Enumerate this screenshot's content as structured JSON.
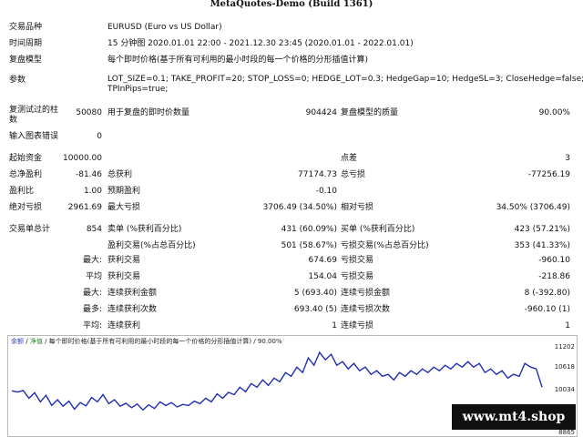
{
  "window": {
    "title": "MetaQuotes-Demo (Build 1361)"
  },
  "report": {
    "symbol_label": "交易品种",
    "symbol_value": "EURUSD (Euro vs US Dollar)",
    "period_label": "时间周期",
    "period_value": "15 分钟图 2020.01.01 22:00 - 2021.12.30 23:45 (2020.01.01 - 2022.01.01)",
    "model_label": "复盘模型",
    "model_value": "每个即时价格(基于所有可利用的最小时段的每一个价格的分形插值计算)",
    "params_label": "参数",
    "params_line1": "LOT_SIZE=0.1; TAKE_PROFIT=20; STOP_LOSS=0; HEDGE_LOT=0.3; HedgeGap=10; HedgeSL=3; CloseHedge=false;",
    "params_line2": "TPInPips=true;",
    "bars_label_1": "复测试过的柱",
    "bars_label_2": "数",
    "bars_value": "50080",
    "ticks_label": "用于复盘的即时价数量",
    "ticks_value": "904424",
    "quality_label": "复盘模型的质量",
    "quality_value": "90.00%",
    "errors_label": "输入图表错误",
    "errors_value": "0",
    "deposit_label": "起始资金",
    "deposit_value": "10000.00",
    "spread_label": "点差",
    "spread_value": "3",
    "net_label": "总净盈利",
    "net_value": "-81.46",
    "gross_profit_label": "总获利",
    "gross_profit_value": "77174.73",
    "gross_loss_label": "总亏损",
    "gross_loss_value": "-77256.19",
    "pf_label": "盈利比",
    "pf_value": "1.00",
    "payoff_label": "预期盈利",
    "payoff_value": "-0.10",
    "abs_dd_label": "绝对亏损",
    "abs_dd_value": "2961.69",
    "max_dd_label": "最大亏损",
    "max_dd_value": "3706.49 (34.50%)",
    "rel_dd_label": "相对亏损",
    "rel_dd_value": "34.50% (3706.49)",
    "trades_label": "交易单总计",
    "trades_value": "854",
    "short_label": "卖单 (%获利百分比)",
    "short_value": "431 (60.09%)",
    "long_label": "买单 (%获利百分比)",
    "long_value": "423 (57.21%)",
    "win_label": "盈利交易(%占总百分比)",
    "win_value": "501 (58.67%)",
    "loss_label": "亏损交易(%占总百分比)",
    "loss_value": "353 (41.33%)",
    "largest_label": "最大:",
    "largest_win_label": "获利交易",
    "largest_win_value": "674.69",
    "largest_loss_label": "亏损交易",
    "largest_loss_value": "-960.10",
    "avg_label": "平均",
    "avg_win_label": "获利交易",
    "avg_win_value": "154.04",
    "avg_loss_label": "亏损交易",
    "avg_loss_value": "-218.86",
    "max_cons_label": "最大:",
    "max_cons_win_label": "连续获利金额",
    "max_cons_win_value": "5 (693.40)",
    "max_cons_loss_label": "连续亏损金额",
    "max_cons_loss_value": "8 (-392.80)",
    "most_label": "最多:",
    "most_cons_win_label": "连续获利次数",
    "most_cons_win_value": "693.40 (5)",
    "most_cons_loss_label": "连续亏损次数",
    "most_cons_loss_value": "-960.10 (1)",
    "avg_cons_label": "平均:",
    "avg_cons_win_label": "连续获利",
    "avg_cons_win_value": "1",
    "avg_cons_loss_label": "连续亏损",
    "avg_cons_loss_value": "1"
  },
  "chart": {
    "legend_balance": "余额",
    "legend_equity": "净值",
    "legend_rest": "/ 每个即时价格(基于所有可利用的最小时段的每一个价格的分形插值计算) / 90.00%",
    "y_ticks": [
      "11202",
      "10618",
      "10034",
      "9449",
      "8865"
    ],
    "line_color": "#1f2fb0",
    "chart_data": {
      "type": "line",
      "title": "",
      "xlabel": "",
      "ylabel": "",
      "ylim": [
        8865,
        11202
      ],
      "series": [
        {
          "values": [
            10000,
            9970,
            10010,
            9800,
            9950,
            9700,
            9880,
            9600,
            9760,
            9580,
            9720,
            9500,
            9680,
            9590,
            9820,
            9700,
            9900,
            9650,
            9760,
            9580,
            9660,
            9540,
            9640,
            9480,
            9620,
            9520,
            9700,
            9600,
            9680,
            9560,
            9630,
            9600,
            9720,
            9650,
            9800,
            9700,
            9920,
            9800,
            9960,
            9900,
            10100,
            9980,
            10200,
            10100,
            10300,
            10150,
            10350,
            10250,
            10500,
            10400,
            10650,
            10500,
            10900,
            10700,
            11050,
            10850,
            11000,
            10700,
            10800,
            10600,
            10750,
            10550,
            10650,
            10450,
            10550,
            10400,
            10450,
            10300,
            10500,
            10400,
            10550,
            10450,
            10600,
            10500,
            10650,
            10550,
            10700,
            10600,
            10750,
            10650,
            10800,
            10650,
            10750,
            10500,
            10600,
            10450,
            10550,
            10350,
            10450,
            10400,
            10750,
            10650,
            10600,
            10100
          ]
        }
      ]
    }
  },
  "watermark": {
    "text": "www.mt4.shop"
  }
}
